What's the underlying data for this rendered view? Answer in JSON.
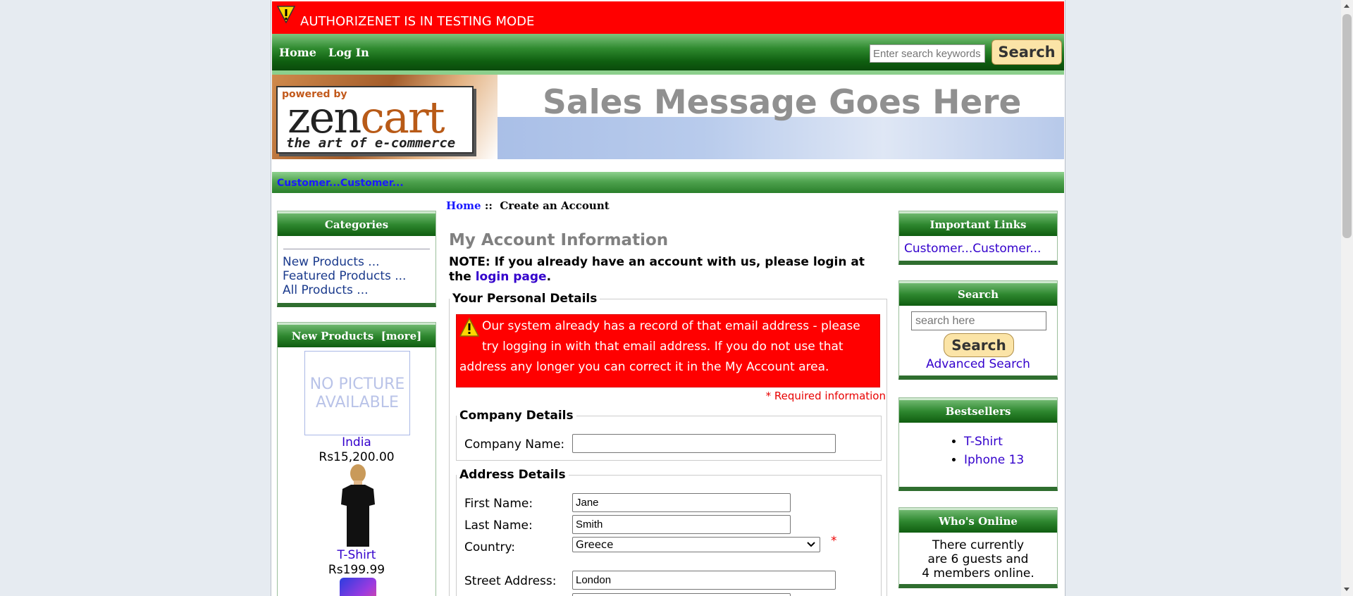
{
  "warning": {
    "text": "AUTHORIZENET IS IN TESTING MODE",
    "icon": "warning-icon"
  },
  "nav": {
    "links": [
      "Home",
      "Log In"
    ],
    "search_placeholder": "Enter search keywords",
    "search_button": "Search"
  },
  "banner": {
    "logo_powered": "powered by",
    "logo_zen": "zen",
    "logo_cart": "cart",
    "logo_tagline": "the art of e-commerce",
    "sales_message": "Sales Message Goes Here"
  },
  "ez_pages_link": "Customer...Customer...",
  "left": {
    "categories": {
      "title": "Categories",
      "items": [
        "New Products ...",
        "Featured Products ...",
        "All Products ..."
      ]
    },
    "new_products": {
      "title": "New Products",
      "more": "[more]",
      "no_picture_line1": "NO PICTURE",
      "no_picture_line2": "AVAILABLE",
      "products": [
        {
          "name": "India",
          "price": "Rs15,200.00"
        },
        {
          "name": "T-Shirt",
          "price": "Rs199.99"
        }
      ]
    }
  },
  "breadcrumb": {
    "home": "Home",
    "separator": "::",
    "current": "Create an Account"
  },
  "main": {
    "title": "My Account Information",
    "note_prefix": "NOTE: If you already have an account with us, please login at the ",
    "note_link": "login page",
    "note_suffix": ".",
    "personal_legend": "Your Personal Details",
    "error_message": "Our system already has a record of that email address - please try logging in with that email address. If you do not use that address any longer you can correct it in the My Account area.",
    "required_info": "* Required information",
    "company": {
      "legend": "Company Details",
      "label": "Company Name:",
      "value": ""
    },
    "address": {
      "legend": "Address Details",
      "first_name_label": "First Name:",
      "first_name": "Jane",
      "last_name_label": "Last Name:",
      "last_name": "Smith",
      "country_label": "Country:",
      "country": "Greece",
      "required_star": "*",
      "street_label": "Street Address:",
      "street": "London"
    }
  },
  "right": {
    "important_links": {
      "title": "Important Links",
      "link": "Customer...Customer..."
    },
    "search": {
      "title": "Search",
      "placeholder": "search here",
      "button": "Search",
      "advanced": "Advanced Search"
    },
    "bestsellers": {
      "title": "Bestsellers",
      "items": [
        "T-Shirt",
        "Iphone 13"
      ]
    },
    "whos_online": {
      "title": "Who's Online",
      "line1": "There currently",
      "line2": "are 6 guests and",
      "line3": "4 members online."
    }
  },
  "colors": {
    "warning_red": "#ff0000",
    "nav_green": "#0f5f10",
    "link_blue": "#3300cc",
    "title_grey": "#808080"
  }
}
